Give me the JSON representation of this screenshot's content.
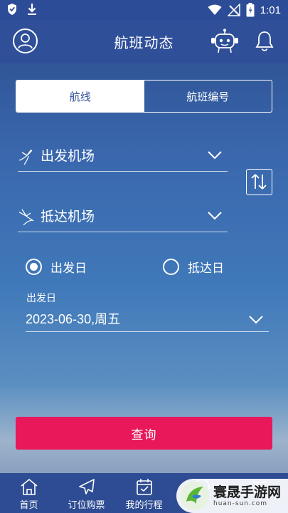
{
  "status_bar": {
    "time": "1:01"
  },
  "header": {
    "title": "航班动态"
  },
  "tabs": [
    {
      "label": "航线",
      "active": true
    },
    {
      "label": "航班编号",
      "active": false
    }
  ],
  "form": {
    "departure_placeholder": "出发机场",
    "arrival_placeholder": "抵达机场",
    "radio_options": [
      {
        "label": "出发日",
        "checked": true
      },
      {
        "label": "抵达日",
        "checked": false
      }
    ],
    "date_caption": "出发日",
    "date_value": "2023-06-30,周五",
    "query_label": "查询"
  },
  "bottom_nav": [
    {
      "label": "首页",
      "icon": "home-icon"
    },
    {
      "label": "订位购票",
      "icon": "plane-icon"
    },
    {
      "label": "我的行程",
      "icon": "calendar-icon"
    },
    {
      "label": "",
      "icon": "compass-icon"
    },
    {
      "label": "",
      "icon": "menu-icon"
    }
  ],
  "watermark": {
    "main": "寰晟手游网",
    "sub": "huan-sun.com"
  },
  "colors": {
    "header": "#2f4f99",
    "accent": "#e8185a",
    "nav": "#2e4c93"
  }
}
